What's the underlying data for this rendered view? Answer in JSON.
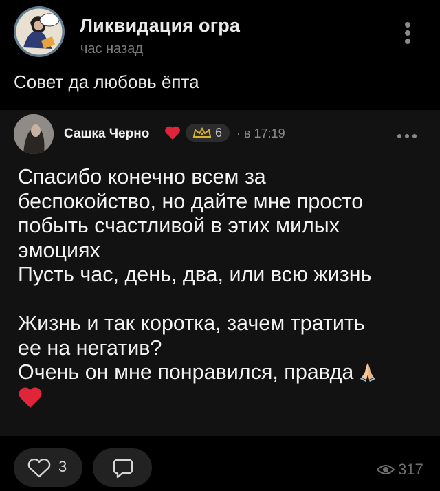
{
  "post": {
    "group_name": "Ликвидация огра",
    "time": "час назад",
    "caption": "Совет да любовь ёпта"
  },
  "repost": {
    "author": "Сашка Черно",
    "level": "6",
    "time": "· в 17:19",
    "lines": [
      "Спасибо конечно всем за",
      "беспокойство, но дайте мне просто",
      "побыть счастливой в этих милых",
      "эмоциях",
      "Пусть час, день, два, или всю жизнь",
      "",
      "Жизнь и так коротка, зачем тратить",
      "ее на негатив?",
      "Очень он мне понравился, правда"
    ]
  },
  "actions": {
    "likes": "3",
    "views": "317"
  },
  "icons": [
    "more-vertical-icon",
    "heart-icon",
    "level-crown-icon",
    "more-horizontal-icon",
    "praying-hands-emoji",
    "like-heart-icon",
    "comment-icon",
    "eye-icon"
  ],
  "colors": {
    "background": "#000000",
    "repost_bg": "#121212",
    "heart": "#e0243a",
    "muted": "#7a7a7a",
    "pill": "#222222"
  }
}
